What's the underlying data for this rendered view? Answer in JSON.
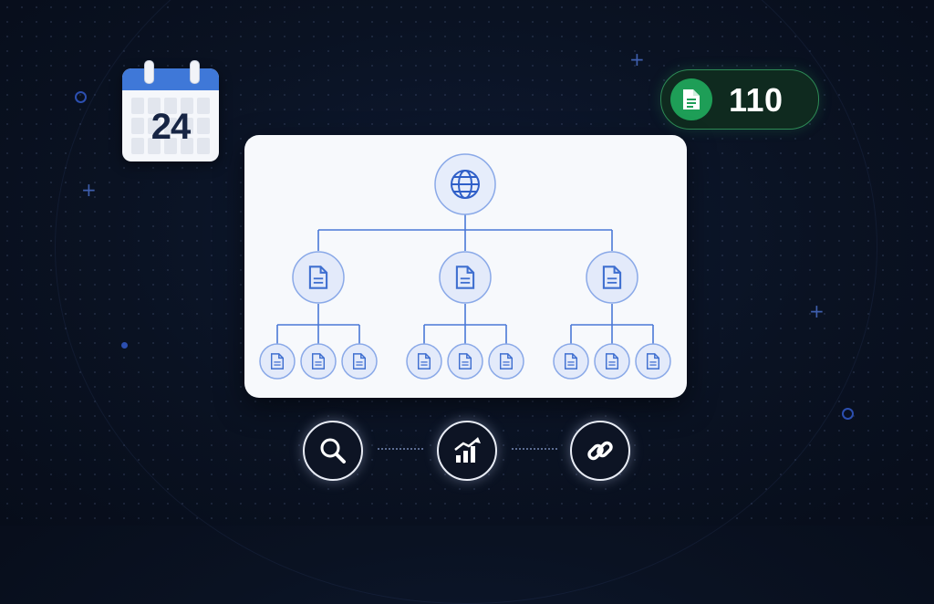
{
  "calendar": {
    "day": "24",
    "icon": "calendar-icon",
    "accent": "#3f78d8"
  },
  "counter": {
    "value": "110",
    "icon": "document-icon",
    "accent": "#1e9e57"
  },
  "tree": {
    "root_icon": "globe-icon",
    "child_icon": "document-icon",
    "page_icon": "document-icon",
    "accent": "#3f6fd0"
  },
  "tools": [
    {
      "icon": "search-icon"
    },
    {
      "icon": "growth-chart-icon"
    },
    {
      "icon": "link-icon"
    }
  ]
}
